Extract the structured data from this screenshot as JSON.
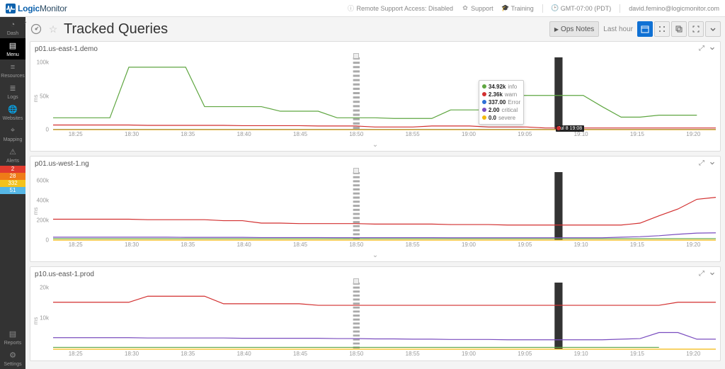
{
  "topbar": {
    "brand1": "Logic",
    "brand2": "Monitor",
    "remote_support": "Remote Support Access: Disabled",
    "support": "Support",
    "training": "Training",
    "timezone": "GMT-07:00 (PDT)",
    "user": "david.femino@logicmonitor.com"
  },
  "sidebar": {
    "items": [
      {
        "label": "Dash"
      },
      {
        "label": "Menu",
        "active": true
      },
      {
        "label": "Resources"
      },
      {
        "label": "Logs"
      },
      {
        "label": "Websites"
      },
      {
        "label": "Mapping"
      },
      {
        "label": "Alerts"
      }
    ],
    "alerts": [
      {
        "count": "2",
        "color": "#e13b2e"
      },
      {
        "count": "28",
        "color": "#ef7b17"
      },
      {
        "count": "332",
        "color": "#f4c21c"
      },
      {
        "count": "51",
        "color": "#56b7e6"
      }
    ],
    "footer": [
      {
        "label": "Reports"
      },
      {
        "label": "Settings"
      }
    ]
  },
  "header": {
    "title": "Tracked Queries",
    "ops_notes": "Ops Notes",
    "time_label": "Last hour"
  },
  "legend_colors": {
    "info": "#5fa641",
    "warn": "#d22f2f",
    "error": "#2d6fd6",
    "critical": "#7a4dbf",
    "severe": "#f2b90c"
  },
  "cursor": {
    "time_label": "Jul 8 19:08"
  },
  "x_ticks": [
    "18:25",
    "18:30",
    "18:35",
    "18:40",
    "18:45",
    "18:50",
    "18:55",
    "19:00",
    "19:05",
    "19:10",
    "19:15",
    "19:20"
  ],
  "tooltip": {
    "rows": [
      {
        "color": "#5fa641",
        "value": "34.92k",
        "name": "info"
      },
      {
        "color": "#d22f2f",
        "value": "2.36k",
        "name": "warn"
      },
      {
        "color": "#2d6fd6",
        "value": "337.00",
        "name": "Error"
      },
      {
        "color": "#7a4dbf",
        "value": "2.00",
        "name": "critical"
      },
      {
        "color": "#f2b90c",
        "value": "0.0",
        "name": "severe"
      }
    ]
  },
  "chart_data": [
    {
      "id": 0,
      "title": "p01.us-east-1.demo",
      "type": "line",
      "ylabel": "ms",
      "ylim": [
        0,
        110000
      ],
      "y_ticks": [
        {
          "v": 0,
          "l": "0"
        },
        {
          "v": 50000,
          "l": "50k"
        },
        {
          "v": 100000,
          "l": "100k"
        }
      ],
      "ops_marker_x": "18:50",
      "cursor_x": "19:08",
      "has_tooltip": true,
      "series": [
        {
          "name": "info",
          "color": "#5fa641",
          "values": [
            18000,
            18000,
            18000,
            18000,
            95000,
            95000,
            95000,
            95000,
            35000,
            35000,
            35000,
            35000,
            28000,
            28000,
            28000,
            18000,
            18000,
            18000,
            17000,
            17000,
            17000,
            30000,
            30000,
            30000,
            52000,
            52000,
            52000,
            52000,
            52000,
            35000,
            19000,
            19000,
            22000,
            22000,
            22000,
            null
          ]
        },
        {
          "name": "warn",
          "color": "#d22f2f",
          "values": [
            7000,
            7000,
            7000,
            7000,
            7000,
            6500,
            6500,
            6500,
            6500,
            6500,
            6000,
            6000,
            6000,
            6000,
            5500,
            5500,
            5500,
            4000,
            4000,
            4000,
            5500,
            5500,
            5500,
            4000,
            4000,
            4000,
            2500,
            2500,
            2500,
            2500,
            2500,
            2500,
            2500,
            2500,
            2500,
            2500
          ]
        },
        {
          "name": "Error",
          "color": "#2d6fd6",
          "values": [
            400,
            400,
            400,
            400,
            400,
            400,
            400,
            400,
            400,
            400,
            400,
            400,
            400,
            400,
            400,
            400,
            400,
            400,
            400,
            400,
            400,
            400,
            400,
            400,
            400,
            400,
            400,
            400,
            400,
            400,
            400,
            400,
            400,
            400,
            400,
            400
          ]
        },
        {
          "name": "critical",
          "color": "#7a4dbf",
          "values": [
            2,
            2,
            2,
            2,
            2,
            2,
            2,
            2,
            2,
            2,
            2,
            2,
            2,
            2,
            2,
            2,
            2,
            2,
            2,
            2,
            2,
            2,
            2,
            2,
            2,
            2,
            2,
            2,
            2,
            2,
            2,
            2,
            2,
            2,
            2,
            2
          ]
        },
        {
          "name": "severe",
          "color": "#f2b90c",
          "values": [
            0,
            0,
            0,
            0,
            0,
            0,
            0,
            0,
            0,
            0,
            0,
            0,
            0,
            0,
            0,
            0,
            0,
            0,
            0,
            0,
            0,
            0,
            0,
            0,
            0,
            0,
            0,
            0,
            0,
            0,
            0,
            0,
            0,
            0,
            0,
            0
          ]
        }
      ]
    },
    {
      "id": 1,
      "title": "p01.us-west-1.ng",
      "type": "line",
      "ylabel": "ms",
      "ylim": [
        0,
        700000
      ],
      "y_ticks": [
        {
          "v": 0,
          "l": "0"
        },
        {
          "v": 200000,
          "l": "200k"
        },
        {
          "v": 400000,
          "l": "400k"
        },
        {
          "v": 600000,
          "l": "600k"
        }
      ],
      "ops_marker_x": "18:50",
      "cursor_x": "19:08",
      "has_tooltip": false,
      "series": [
        {
          "name": "info",
          "color": "#5fa641",
          "values": [
            15000,
            15000,
            15000,
            15000,
            15000,
            15000,
            15000,
            15000,
            15000,
            15000,
            15000,
            15000,
            15000,
            15000,
            15000,
            15000,
            15000,
            15000,
            15000,
            15000,
            15000,
            15000,
            15000,
            15000,
            15000,
            15000,
            15000,
            15000,
            15000,
            15000,
            15000,
            15000,
            15000,
            15000,
            15000,
            15000
          ]
        },
        {
          "name": "warn",
          "color": "#d22f2f",
          "values": [
            215000,
            215000,
            215000,
            215000,
            215000,
            210000,
            210000,
            210000,
            210000,
            200000,
            200000,
            175000,
            175000,
            170000,
            170000,
            170000,
            170000,
            165000,
            165000,
            165000,
            165000,
            160000,
            160000,
            160000,
            155000,
            155000,
            155000,
            155000,
            155000,
            155000,
            155000,
            175000,
            250000,
            320000,
            420000,
            440000
          ]
        },
        {
          "name": "critical",
          "color": "#7a4dbf",
          "values": [
            30000,
            30000,
            30000,
            30000,
            30000,
            30000,
            30000,
            28000,
            28000,
            28000,
            28000,
            26000,
            26000,
            26000,
            26000,
            25000,
            25000,
            25000,
            25000,
            25000,
            25000,
            24000,
            24000,
            24000,
            24000,
            24000,
            24000,
            24000,
            24000,
            24000,
            30000,
            35000,
            45000,
            60000,
            72000,
            75000
          ]
        },
        {
          "name": "severe",
          "color": "#f2b90c",
          "values": [
            0,
            0,
            0,
            0,
            0,
            0,
            0,
            0,
            0,
            0,
            0,
            0,
            0,
            0,
            0,
            0,
            0,
            0,
            0,
            0,
            0,
            0,
            0,
            0,
            0,
            0,
            0,
            0,
            0,
            0,
            0,
            0,
            0,
            0,
            0,
            0
          ]
        }
      ]
    },
    {
      "id": 2,
      "title": "p10.us-east-1.prod",
      "type": "line",
      "ylabel": "ms",
      "ylim": [
        0,
        22000
      ],
      "y_ticks": [
        {
          "v": 10000,
          "l": "10k"
        },
        {
          "v": 20000,
          "l": "20k"
        }
      ],
      "ops_marker_x": "18:50",
      "cursor_x": "19:08",
      "has_tooltip": false,
      "series": [
        {
          "name": "info",
          "color": "#5fa641",
          "values": [
            600,
            600,
            600,
            600,
            600,
            600,
            600,
            600,
            600,
            600,
            600,
            600,
            600,
            600,
            600,
            600,
            600,
            600,
            600,
            600,
            600,
            600,
            600,
            600,
            600,
            600,
            600,
            600,
            600,
            600,
            600,
            600,
            600,
            null,
            null,
            null
          ]
        },
        {
          "name": "warn",
          "color": "#d22f2f",
          "values": [
            15500,
            15500,
            15500,
            15500,
            15500,
            17500,
            17500,
            17500,
            17500,
            15000,
            15000,
            15000,
            15000,
            15000,
            14500,
            14500,
            14500,
            14500,
            14500,
            14500,
            14500,
            14500,
            14500,
            14500,
            14500,
            14500,
            14500,
            14500,
            14500,
            14500,
            14500,
            14500,
            14500,
            15500,
            15500,
            15500
          ]
        },
        {
          "name": "critical",
          "color": "#7a4dbf",
          "values": [
            3800,
            3800,
            3800,
            3800,
            3800,
            3700,
            3700,
            3700,
            3700,
            3700,
            3600,
            3600,
            3600,
            3600,
            3600,
            3500,
            3500,
            3400,
            3400,
            3300,
            3300,
            3200,
            3200,
            3200,
            3100,
            3100,
            3100,
            3100,
            3100,
            3100,
            3300,
            3500,
            5500,
            5500,
            3300,
            3300
          ]
        },
        {
          "name": "severe",
          "color": "#f2b90c",
          "values": [
            0,
            0,
            0,
            0,
            0,
            0,
            0,
            0,
            0,
            0,
            0,
            0,
            0,
            0,
            0,
            0,
            0,
            0,
            0,
            0,
            0,
            0,
            0,
            0,
            0,
            0,
            0,
            0,
            0,
            0,
            0,
            0,
            0,
            0,
            0,
            0
          ]
        }
      ]
    }
  ]
}
